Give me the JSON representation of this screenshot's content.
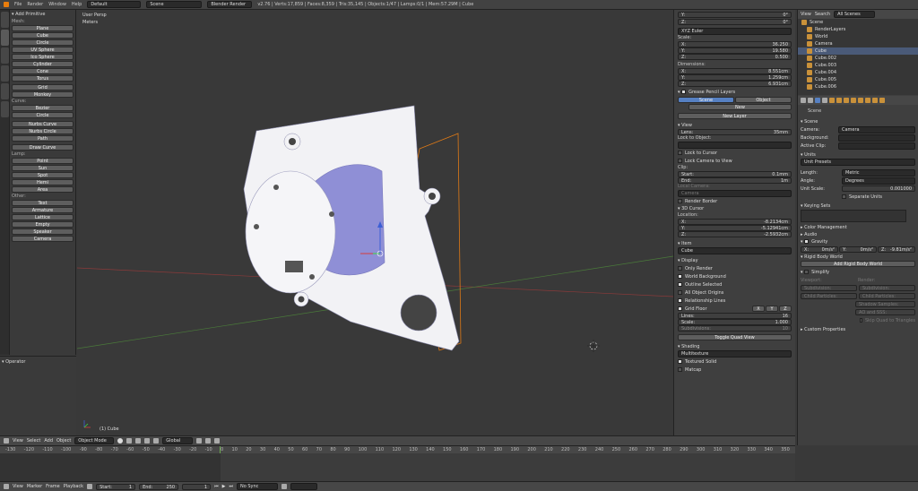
{
  "topbar": {
    "menus": [
      "File",
      "Render",
      "Window",
      "Help"
    ],
    "layout": "Default",
    "scene": "Scene",
    "engine": "Blender Render",
    "stats": "v2.76 | Verts:17,859 | Faces:8,359 | Tris:35,145 | Objects:1/47 | Lamps:0/1 | Mem:57.29M | Cube"
  },
  "toolshelf": {
    "title": "Add Primitive",
    "sections": [
      {
        "label": "Mesh:",
        "items": [
          "Plane",
          "Cube",
          "Circle",
          "UV Sphere",
          "Ico Sphere",
          "Cylinder",
          "Cone",
          "Torus"
        ]
      },
      {
        "label": "",
        "items": [
          "Grid",
          "Monkey"
        ]
      },
      {
        "label": "Curve:",
        "items": [
          "Bezier",
          "Circle"
        ]
      },
      {
        "label": "",
        "items": [
          "Nurbs Curve",
          "Nurbs Circle",
          "Path"
        ]
      },
      {
        "label": "",
        "items": [
          "Draw Curve"
        ]
      },
      {
        "label": "Lamp:",
        "items": [
          "Point",
          "Sun",
          "Spot",
          "Hemi",
          "Area"
        ]
      },
      {
        "label": "Other:",
        "items": [
          "Text",
          "Armature",
          "Lattice",
          "Empty",
          "Speaker",
          "Camera"
        ]
      }
    ],
    "tabs": [
      "Tools",
      "Create",
      "Relations",
      "Animation",
      "Physics",
      "Grease Pencil"
    ]
  },
  "operator": {
    "title": "Operator"
  },
  "viewport": {
    "view_name": "User Persp",
    "units": "Meters",
    "object_label": "(1) Cube"
  },
  "npanel": {
    "rotation": [
      {
        "axis": "Y:",
        "value": "0°"
      },
      {
        "axis": "Z:",
        "value": "0°"
      }
    ],
    "rot_mode": "XYZ Euler",
    "scale_label": "Scale:",
    "scale": [
      {
        "axis": "X:",
        "value": "36.250"
      },
      {
        "axis": "Y:",
        "value": "19.580"
      },
      {
        "axis": "Z:",
        "value": "0.500"
      }
    ],
    "dims_label": "Dimensions:",
    "dims": [
      {
        "axis": "X:",
        "value": "8.551cm"
      },
      {
        "axis": "Y:",
        "value": "1.259cm"
      },
      {
        "axis": "Z:",
        "value": "6.931cm"
      }
    ],
    "gp_title": "Grease Pencil Layers",
    "gp_scene": "Scene",
    "gp_object": "Object",
    "gp_new": "New",
    "gp_newlayer": "New Layer",
    "view_title": "View",
    "lens_label": "Lens:",
    "lens_value": "35mm",
    "lock_label": "Lock to Object:",
    "lock_cursor": "Lock to Cursor",
    "lock_camera": "Lock Camera to View",
    "clip_label": "Clip:",
    "clip_start": "Start:",
    "clip_start_v": "0.1mm",
    "clip_end": "End:",
    "clip_end_v": "1m",
    "local_camera": "Local Camera:",
    "camera_field": "Camera",
    "render_border": "Render Border",
    "cursor_title": "3D Cursor",
    "location_label": "Location:",
    "cursor": [
      {
        "axis": "X:",
        "value": "-8.2134cm"
      },
      {
        "axis": "Y:",
        "value": "-5.12941cm"
      },
      {
        "axis": "Z:",
        "value": "-2.5932cm"
      }
    ],
    "item_title": "Item",
    "item_name": "Cube",
    "display_title": "Display",
    "display_opts": [
      "Only Render",
      "World Background",
      "Outline Selected",
      "All Object Origins",
      "Relationship Lines"
    ],
    "grid_floor": "Grid Floor",
    "axes": [
      "X",
      "Y",
      "Z"
    ],
    "grid": [
      {
        "axis": "Lines:",
        "value": "16"
      },
      {
        "axis": "Scale:",
        "value": "1.000"
      },
      {
        "axis": "Subdivisions:",
        "value": "10"
      }
    ],
    "toggle_quad": "Toggle Quad View",
    "shading_title": "Shading",
    "shading_mode": "Multitexture",
    "textured_solid": "Textured Solid",
    "matcap": "Matcap"
  },
  "outliner": {
    "view": "View",
    "search": "Search",
    "filter": "All Scenes",
    "items": [
      "Scene",
      "RenderLayers",
      "World",
      "Camera",
      "Cube",
      "Cube.002",
      "Cube.003",
      "Cube.004",
      "Cube.005",
      "Cube.006"
    ]
  },
  "props": {
    "breadcrumb": "Scene",
    "scene_title": "Scene",
    "camera_label": "Camera:",
    "camera_value": "Camera",
    "background_label": "Background:",
    "clip_label": "Active Clip:",
    "units_title": "Units",
    "unit_presets": "Unit Presets",
    "length_label": "Length:",
    "length_value": "Metric",
    "angle_label": "Angle:",
    "angle_value": "Degrees",
    "unit_scale_label": "Unit Scale:",
    "unit_scale_value": "0.001000",
    "separate_units": "Separate Units",
    "keying_title": "Keying Sets",
    "color_mgmt": "Color Management",
    "audio": "Audio",
    "gravity": "Gravity",
    "gravity_vals": [
      {
        "axis": "X:",
        "value": "0m/s²"
      },
      {
        "axis": "Y:",
        "value": "0m/s²"
      },
      {
        "axis": "Z:",
        "value": "-9.81m/s²"
      }
    ],
    "rbw_title": "Rigid Body World",
    "rbw_btn": "Add Rigid Body World",
    "simplify": "Simplify",
    "viewport_label": "Viewport:",
    "render_label": "Render:",
    "subdivision": "Subdivision:",
    "child_particles": "Child Particles:",
    "shadow_samples": "Shadow Samples:",
    "ao_sss": "AO and SSS:",
    "skip_quad": "Skip Quad to Triangles",
    "custom_props": "Custom Properties"
  },
  "viewheader": {
    "menus": [
      "View",
      "Select",
      "Add",
      "Object"
    ],
    "mode": "Object Mode",
    "orient": "Global"
  },
  "timeline": {
    "ticks": [
      "-130",
      "-120",
      "-110",
      "-100",
      "-90",
      "-80",
      "-70",
      "-60",
      "-50",
      "-40",
      "-30",
      "-20",
      "-10",
      "0",
      "10",
      "20",
      "30",
      "40",
      "50",
      "60",
      "70",
      "80",
      "90",
      "100",
      "110",
      "120",
      "130",
      "140",
      "150",
      "160",
      "170",
      "180",
      "190",
      "200",
      "210",
      "220",
      "230",
      "240",
      "250",
      "260",
      "270",
      "280",
      "290",
      "300",
      "310",
      "320",
      "330",
      "340",
      "350"
    ]
  },
  "bottombar": {
    "menus": [
      "View",
      "Marker",
      "Frame",
      "Playback"
    ],
    "start_label": "Start:",
    "start": "1",
    "end_label": "End:",
    "end": "250",
    "current": "1",
    "sync": "No Sync"
  }
}
